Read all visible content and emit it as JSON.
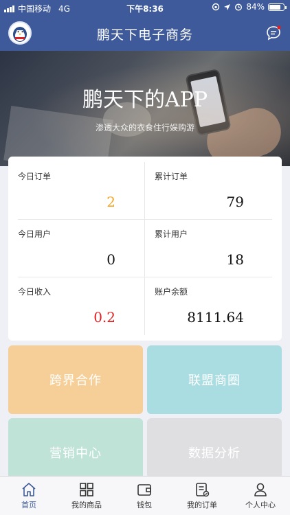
{
  "status_bar": {
    "carrier": "中国移动",
    "network": "4G",
    "time": "下午8:36",
    "battery": "84%",
    "battery_level": 0.84
  },
  "header": {
    "title": "鹏天下电子商务",
    "avatar_icon": "penguin-avatar-icon",
    "message_icon": "message-icon"
  },
  "banner": {
    "title": "鹏天下的APP",
    "subtitle": "渗透大众的衣食住行娱购游"
  },
  "stats": [
    {
      "label": "今日订单",
      "value": "2",
      "color": "#f5a623"
    },
    {
      "label": "累计订单",
      "value": "79",
      "color": "#111111"
    },
    {
      "label": "今日用户",
      "value": "0",
      "color": "#111111"
    },
    {
      "label": "累计用户",
      "value": "18",
      "color": "#111111"
    },
    {
      "label": "今日收入",
      "value": "0.2",
      "color": "#e02020"
    },
    {
      "label": "账户余额",
      "value": "8111.64",
      "color": "#111111"
    }
  ],
  "tiles": [
    {
      "label": "跨界合作",
      "color": "#f5cf97"
    },
    {
      "label": "联盟商圈",
      "color": "#a9dde1"
    },
    {
      "label": "营销中心",
      "color": "#bfe3d7"
    },
    {
      "label": "数据分析",
      "color": "#dfdfe2"
    }
  ],
  "tab_bar": {
    "items": [
      {
        "label": "首页",
        "icon": "home-icon",
        "active": true
      },
      {
        "label": "我的商品",
        "icon": "grid-icon",
        "active": false
      },
      {
        "label": "钱包",
        "icon": "wallet-icon",
        "active": false
      },
      {
        "label": "我的订单",
        "icon": "order-icon",
        "active": false
      },
      {
        "label": "个人中心",
        "icon": "user-icon",
        "active": false
      }
    ]
  },
  "colors": {
    "brand": "#3e5a9a",
    "accent_orange": "#f5a623",
    "accent_red": "#e02020",
    "notification_dot": "#e02020"
  }
}
